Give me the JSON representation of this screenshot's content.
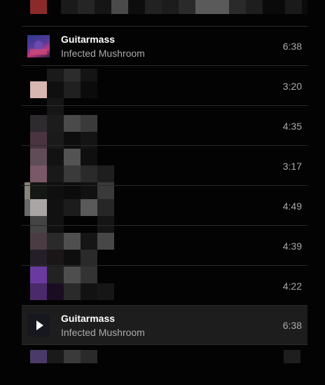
{
  "tracks": [
    {
      "title": "",
      "artist": "",
      "duration": ""
    },
    {
      "title": "Guitarmass",
      "artist": "Infected Mushroom",
      "duration": "6:38"
    },
    {
      "title": "",
      "artist": "",
      "duration": "3:20"
    },
    {
      "title": "",
      "artist": "",
      "duration": "4:35"
    },
    {
      "title": "",
      "artist": "",
      "duration": "3:17"
    },
    {
      "title": "",
      "artist": "",
      "duration": "4:49"
    },
    {
      "title": "",
      "artist": "",
      "duration": "4:39"
    },
    {
      "title": "",
      "artist": "",
      "duration": "4:22"
    },
    {
      "title": "Guitarmass",
      "artist": "Infected Mushroom",
      "duration": "6:38",
      "state": "playing-hover"
    }
  ],
  "icons": {
    "play": "play-icon"
  },
  "colors": {
    "background": "#030303",
    "active_row": "#1d1d1d",
    "secondary_text": "#aaaaaa"
  }
}
